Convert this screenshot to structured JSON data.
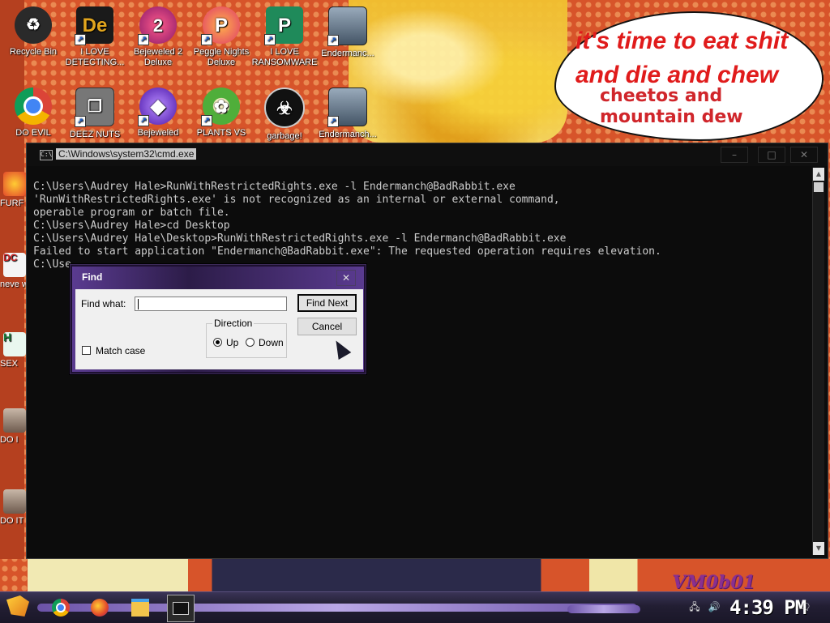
{
  "wallpaper": {
    "bubble_line1": "it's time to eat shit",
    "bubble_line2": "and die and chew",
    "bubble_line3": "cheetos and",
    "bubble_line4": "mountain dew",
    "watermark": "VM0b01"
  },
  "desktop_icons": [
    {
      "label": "Recycle Bin",
      "icon": "recycle-bin-icon",
      "color": "#c03a3a"
    },
    {
      "label": "I LOVE DETECTING...",
      "icon": "detective-icon",
      "color": "#e2a61e"
    },
    {
      "label": "Bejeweled 2 Deluxe",
      "icon": "bejeweled-2-icon",
      "color": "#d12b6a"
    },
    {
      "label": "Peggle Nights Deluxe",
      "icon": "peggle-icon",
      "color": "#e87a1e"
    },
    {
      "label": "I LOVE RANSOMWARE",
      "icon": "publisher-icon",
      "color": "#1f8a5a"
    },
    {
      "label": "Endermanc...",
      "icon": "app-window-icon",
      "color": "#4a5a7a"
    },
    {
      "label": "DO EVIL",
      "icon": "chrome-icon",
      "color": "#2e7bd6"
    },
    {
      "label": "DEEZ NUTS",
      "icon": "copy-icon",
      "color": "#8a8a8a"
    },
    {
      "label": "Bejeweled",
      "icon": "bejeweled-icon",
      "color": "#6a2bd1"
    },
    {
      "label": "PLANTS VS",
      "icon": "plants-icon",
      "color": "#4fae3a"
    },
    {
      "label": "garbage!",
      "icon": "garbage-icon",
      "color": "#222222"
    },
    {
      "label": "Endermanch...",
      "icon": "app-window-icon",
      "color": "#4a5a7a"
    }
  ],
  "edge_icons": [
    {
      "label": "FURF",
      "icon": "firefox-icon"
    },
    {
      "label": "neve why",
      "icon": "text-icon"
    },
    {
      "label": "SEX",
      "icon": "hx-icon"
    },
    {
      "label": "DO I",
      "icon": "portrait-icon"
    },
    {
      "label": "DO IT",
      "icon": "portrait-icon"
    }
  ],
  "cmd": {
    "title": "C:\\Windows\\system32\\cmd.exe",
    "lines": [
      "C:\\Users\\Audrey Hale>RunWithRestrictedRights.exe -l Endermanch@BadRabbit.exe",
      "'RunWithRestrictedRights.exe' is not recognized as an internal or external command,",
      "operable program or batch file.",
      "",
      "C:\\Users\\Audrey Hale>cd Desktop",
      "",
      "C:\\Users\\Audrey Hale\\Desktop>RunWithRestrictedRights.exe -l Endermanch@BadRabbit.exe",
      "Failed to start application \"Endermanch@BadRabbit.exe\": The requested operation requires elevation.",
      "",
      "C:\\Use"
    ],
    "controls": {
      "minimize": "–",
      "maximize": "□",
      "close": "✕"
    }
  },
  "find_dialog": {
    "title": "Find",
    "find_what_label": "Find what:",
    "find_what_value": "",
    "find_next_label": "Find Next",
    "cancel_label": "Cancel",
    "match_case_label": "Match case",
    "match_case_checked": false,
    "direction_label": "Direction",
    "up_label": "Up",
    "down_label": "Down",
    "selected_direction": "Up"
  },
  "taskbar": {
    "clock": "4:39 PM",
    "apps": [
      "chrome-icon",
      "firefox-icon",
      "file-explorer-icon",
      "cmd-icon"
    ]
  }
}
